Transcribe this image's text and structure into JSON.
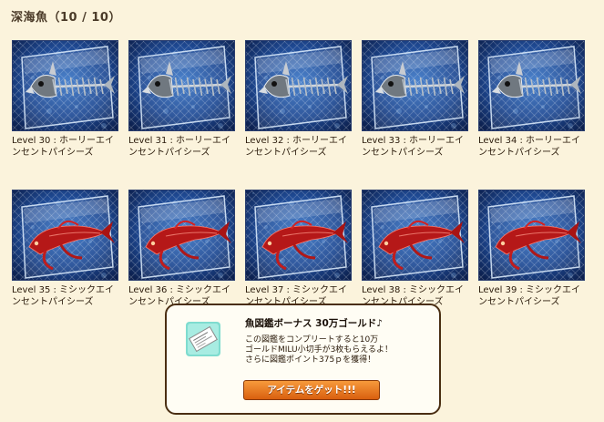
{
  "header": {
    "title": "深海魚（10 / 10）"
  },
  "items": [
    {
      "label": "Level 30 : ホーリーエインセントパイシーズ",
      "kind": "skeleton"
    },
    {
      "label": "Level 31 : ホーリーエインセントパイシーズ",
      "kind": "skeleton"
    },
    {
      "label": "Level 32 : ホーリーエインセントパイシーズ",
      "kind": "skeleton"
    },
    {
      "label": "Level 33 : ホーリーエインセントパイシーズ",
      "kind": "skeleton"
    },
    {
      "label": "Level 34 : ホーリーエインセントパイシーズ",
      "kind": "skeleton"
    },
    {
      "label": "Level 35 : ミシックエインセントパイシーズ",
      "kind": "red"
    },
    {
      "label": "Level 36 : ミシックエインセントパイシーズ",
      "kind": "red"
    },
    {
      "label": "Level 37 : ミシックエインセントパイシーズ",
      "kind": "red"
    },
    {
      "label": "Level 38 : ミシックエインセントパイシーズ",
      "kind": "red"
    },
    {
      "label": "Level 39 : ミシックエインセントパイシーズ",
      "kind": "red"
    }
  ],
  "bonus": {
    "title": "魚図鑑ボーナス 30万ゴールド♪",
    "desc_line1": "この図鑑をコンプリートすると10万",
    "desc_line2": "ゴールドMILU小切手が3枚もらえるよ！",
    "desc_line3": "さらに図鑑ポイント375ｐを獲得！",
    "button": "アイテムをゲット!!!"
  },
  "colors": {
    "background": "#fbf3dc",
    "border": "#4a2e12",
    "button": "#e87520"
  }
}
